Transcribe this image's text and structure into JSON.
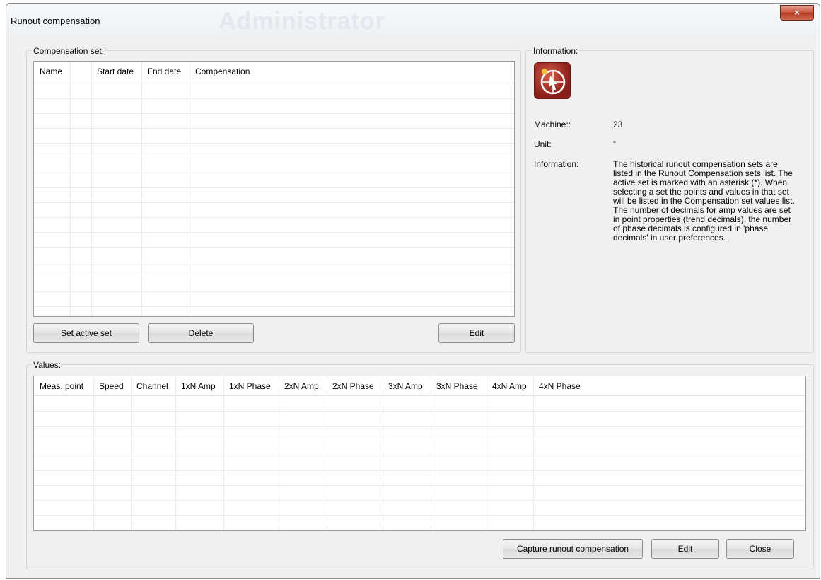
{
  "window": {
    "title": "Runout compensation",
    "watermark": "Administrator",
    "close_glyph": "×"
  },
  "compensation_set": {
    "label": "Compensation set:",
    "columns": [
      "Name",
      "",
      "Start date",
      "End date",
      "Compensation"
    ],
    "rows": [],
    "buttons": {
      "set_active": "Set active set",
      "delete": "Delete",
      "edit": "Edit"
    }
  },
  "information": {
    "label": "Information:",
    "icon": "runout-app-icon",
    "machine_label": "Machine::",
    "machine_value": "23",
    "unit_label": "Unit:",
    "unit_value": "-",
    "info_label": "Information:",
    "info_text": "The historical runout compensation sets are listed in the Runout Compensation sets list. The active set is marked with an asterisk (*). When selecting a set the points and values in that set will be listed in the Compensation set values list. The number of decimals for amp values are set in point properties (trend decimals), the number of phase decimals is configured in 'phase decimals' in user preferences."
  },
  "values": {
    "label": "Values:",
    "columns": [
      "Meas. point",
      "Speed",
      "Channel",
      "1xN Amp",
      "1xN Phase",
      "2xN Amp",
      "2xN Phase",
      "3xN Amp",
      "3xN Phase",
      "4xN Amp",
      "4xN Phase"
    ],
    "rows": []
  },
  "footer": {
    "capture": "Capture runout compensation",
    "edit": "Edit",
    "close": "Close"
  },
  "colors": {
    "window_bg": "#f0f0f0",
    "close_button": "#c8523c",
    "icon_red": "#8a1e18"
  }
}
